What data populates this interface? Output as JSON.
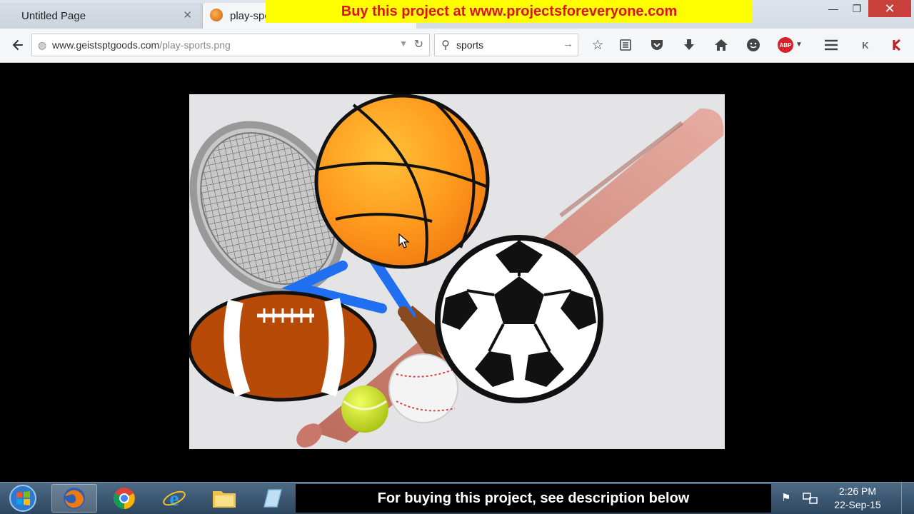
{
  "window": {
    "tabs": [
      {
        "label": "Untitled Page",
        "close": "✕"
      },
      {
        "label": "play-sports.png"
      }
    ],
    "banner_text": "Buy this project at www.projectsforeveryone.com",
    "controls": {
      "minimize": "—",
      "maximize": "❐",
      "close": "✕"
    }
  },
  "nav": {
    "url_host": "www.geistsptgoods.com",
    "url_path": "/play-sports.png",
    "search_value": "sports",
    "icons": [
      "back-icon",
      "globe-icon",
      "reload-icon",
      "search-icon",
      "bookmark-star-icon",
      "reading-list-icon",
      "pocket-icon",
      "download-icon",
      "home-icon",
      "hello-icon",
      "adblock-icon",
      "menu-icon",
      "k-extension-icon",
      "kaspersky-icon"
    ],
    "abp_label": "ABP",
    "k_label": "K"
  },
  "content": {
    "image_alt": "Sports equipment: basketball, tennis racket, baseball bat, football, soccer ball, baseball, tennis ball"
  },
  "taskbar": {
    "bottom_banner": "For buying this project,  see description below",
    "time": "2:26 PM",
    "date": "22-Sep-15",
    "items": [
      "start-button",
      "firefox",
      "chrome",
      "internet-explorer",
      "file-explorer",
      "notepad"
    ]
  },
  "colors": {
    "banner_bg": "#ffff00",
    "banner_text": "#e0101a",
    "page_bg": "#000000",
    "taskbar": "#2d4660"
  }
}
